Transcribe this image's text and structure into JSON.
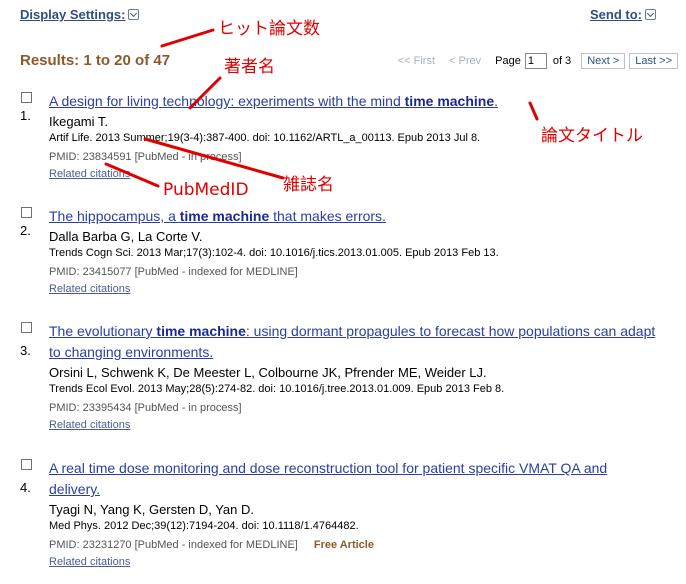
{
  "header": {
    "display_settings_label": "Display Settings:",
    "send_to_label": "Send to:"
  },
  "results_bar": {
    "count_text": "Results: 1 to 20 of 47",
    "first_label": "<< First",
    "prev_label": "< Prev",
    "page_label": "Page",
    "page_value": "1",
    "of_label": "of 3",
    "next_label": "Next >",
    "last_label": "Last >>"
  },
  "results": [
    {
      "number": "1.",
      "title_parts": [
        "A design for living technology: experiments with the mind ",
        "time machine",
        "."
      ],
      "authors": "Ikegami T.",
      "journal": "Artif Life. 2013 Summer;19(3-4):387-400. doi: 10.1162/ARTL_a_00113. Epub 2013 Jul 8.",
      "pmid": "PMID: 23834591 [PubMed - in process]",
      "free": "",
      "related": "Related citations"
    },
    {
      "number": "2.",
      "title_parts": [
        "The hippocampus, a ",
        "time machine",
        " that makes errors."
      ],
      "authors": "Dalla Barba G, La Corte V.",
      "journal": "Trends Cogn Sci. 2013 Mar;17(3):102-4. doi: 10.1016/j.tics.2013.01.005. Epub 2013 Feb 13.",
      "pmid": "PMID: 23415077 [PubMed - indexed for MEDLINE]",
      "free": "",
      "related": "Related citations"
    },
    {
      "number": "3.",
      "title_parts": [
        "The evolutionary ",
        "time machine",
        ": using dormant propagules to forecast how populations can adapt to changing environments."
      ],
      "authors": "Orsini L, Schwenk K, De Meester L, Colbourne JK, Pfrender ME, Weider LJ.",
      "journal": "Trends Ecol Evol. 2013 May;28(5):274-82. doi: 10.1016/j.tree.2013.01.009. Epub 2013 Feb 8.",
      "pmid": "PMID: 23395434 [PubMed - in process]",
      "free": "",
      "related": "Related citations"
    },
    {
      "number": "4.",
      "title_parts": [
        "A real time dose monitoring and dose reconstruction tool for patient specific VMAT QA and delivery.",
        "",
        ""
      ],
      "authors": "Tyagi N, Yang K, Gersten D, Yan D.",
      "journal": "Med Phys. 2012 Dec;39(12):7194-204. doi: 10.1118/1.4764482.",
      "pmid": "PMID: 23231270 [PubMed - indexed for MEDLINE]",
      "free": "Free Article",
      "related": "Related citations"
    }
  ],
  "annotations": {
    "hit_count": "ヒット論文数",
    "author_name": "著者名",
    "paper_title": "論文タイトル",
    "journal_name": "雑誌名",
    "pubmed_id": "PubMedID",
    "color": "#e00000"
  }
}
